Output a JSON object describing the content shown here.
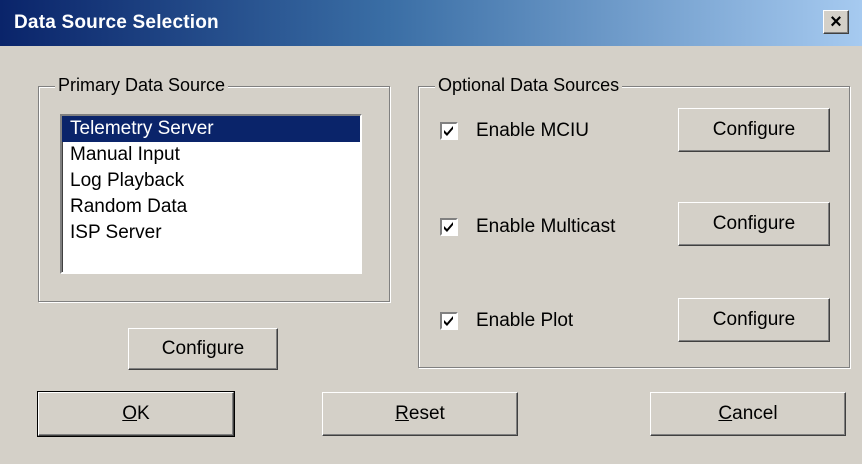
{
  "window": {
    "title": "Data Source Selection",
    "close_glyph": "×",
    "close_icon": "close-icon"
  },
  "primary": {
    "group_label": "Primary Data Source",
    "items": [
      "Telemetry Server",
      "Manual Input",
      "Log Playback",
      "Random Data",
      "ISP Server"
    ],
    "selected_index": 0,
    "configure_label": "Configure"
  },
  "optional": {
    "group_label": "Optional Data Sources",
    "rows": [
      {
        "label": "Enable MCIU",
        "checked": true,
        "configure_label": "Configure"
      },
      {
        "label": "Enable Multicast",
        "checked": true,
        "configure_label": "Configure"
      },
      {
        "label": "Enable Plot",
        "checked": true,
        "configure_label": "Configure"
      }
    ]
  },
  "footer": {
    "ok": {
      "mnemonic": "O",
      "rest": "K"
    },
    "reset": {
      "mnemonic": "R",
      "rest": "eset"
    },
    "cancel": {
      "mnemonic": "C",
      "rest": "ancel"
    }
  },
  "colors": {
    "face": "#d4d0c8",
    "selection": "#0a246a",
    "title_start": "#0a246a",
    "title_end": "#a6caf0"
  }
}
